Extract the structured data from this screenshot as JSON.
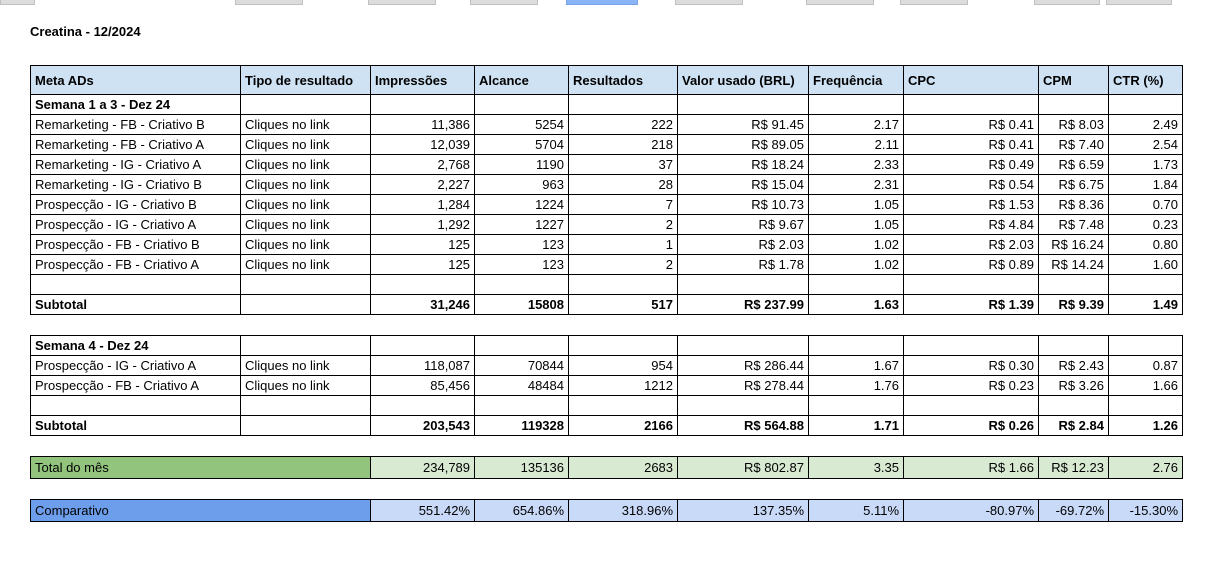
{
  "title": "Creatina - 12/2024",
  "colors": {
    "header_bg": "#cfe2f3",
    "total_label_bg": "#93c47d",
    "total_value_bg": "#d9ead3",
    "comparativo_label_bg": "#6d9eeb",
    "comparativo_value_bg": "#c9daf8",
    "grid_border": "#000000"
  },
  "table": {
    "columns": [
      "Meta ADs",
      "Tipo de resultado",
      "Impressões",
      "Alcance",
      "Resultados",
      "Valor usado (BRL)",
      "Frequência",
      "CPC",
      "CPM",
      "CTR (%)"
    ],
    "sections": [
      {
        "label": "Semana 1 a 3 - Dez 24",
        "rows": [
          [
            "Remarketing - FB - Criativo B",
            "Cliques no link",
            "11,386",
            "5254",
            "222",
            "R$ 91.45",
            "2.17",
            "R$ 0.41",
            "R$ 8.03",
            "2.49"
          ],
          [
            "Remarketing - FB - Criativo A",
            "Cliques no link",
            "12,039",
            "5704",
            "218",
            "R$ 89.05",
            "2.11",
            "R$ 0.41",
            "R$ 7.40",
            "2.54"
          ],
          [
            "Remarketing - IG - Criativo A",
            "Cliques no link",
            "2,768",
            "1190",
            "37",
            "R$ 18.24",
            "2.33",
            "R$ 0.49",
            "R$ 6.59",
            "1.73"
          ],
          [
            "Remarketing - IG - Criativo B",
            "Cliques no link",
            "2,227",
            "963",
            "28",
            "R$ 15.04",
            "2.31",
            "R$ 0.54",
            "R$ 6.75",
            "1.84"
          ],
          [
            "Prospecção - IG - Criativo B",
            "Cliques no link",
            "1,284",
            "1224",
            "7",
            "R$ 10.73",
            "1.05",
            "R$ 1.53",
            "R$ 8.36",
            "0.70"
          ],
          [
            "Prospecção - IG - Criativo A",
            "Cliques no link",
            "1,292",
            "1227",
            "2",
            "R$ 9.67",
            "1.05",
            "R$ 4.84",
            "R$ 7.48",
            "0.23"
          ],
          [
            "Prospecção - FB - Criativo B",
            "Cliques no link",
            "125",
            "123",
            "1",
            "R$ 2.03",
            "1.02",
            "R$ 2.03",
            "R$ 16.24",
            "0.80"
          ],
          [
            "Prospecção - FB - Criativo A",
            "Cliques no link",
            "125",
            "123",
            "2",
            "R$ 1.78",
            "1.02",
            "R$ 0.89",
            "R$ 14.24",
            "1.60"
          ]
        ],
        "subtotal": {
          "label": "Subtotal",
          "values": [
            "31,246",
            "15808",
            "517",
            "R$ 237.99",
            "1.63",
            "R$ 1.39",
            "R$ 9.39",
            "1.49"
          ]
        }
      },
      {
        "label": "Semana 4 - Dez 24",
        "rows": [
          [
            "Prospecção - IG - Criativo A",
            "Cliques no link",
            "118,087",
            "70844",
            "954",
            "R$ 286.44",
            "1.67",
            "R$ 0.30",
            "R$ 2.43",
            "0.87"
          ],
          [
            "Prospecção - FB - Criativo A",
            "Cliques no link",
            "85,456",
            "48484",
            "1212",
            "R$ 278.44",
            "1.76",
            "R$ 0.23",
            "R$ 3.26",
            "1.66"
          ]
        ],
        "subtotal": {
          "label": "Subtotal",
          "values": [
            "203,543",
            "119328",
            "2166",
            "R$ 564.88",
            "1.71",
            "R$ 0.26",
            "R$ 2.84",
            "1.26"
          ]
        }
      }
    ],
    "total": {
      "label": "Total do mês",
      "values": [
        "234,789",
        "135136",
        "2683",
        "R$ 802.87",
        "3.35",
        "R$ 1.66",
        "R$ 12.23",
        "2.76"
      ]
    },
    "comparativo": {
      "label": "Comparativo",
      "values": [
        "551.42%",
        "654.86%",
        "318.96%",
        "137.35%",
        "5.11%",
        "-80.97%",
        "-69.72%",
        "-15.30%"
      ]
    }
  }
}
